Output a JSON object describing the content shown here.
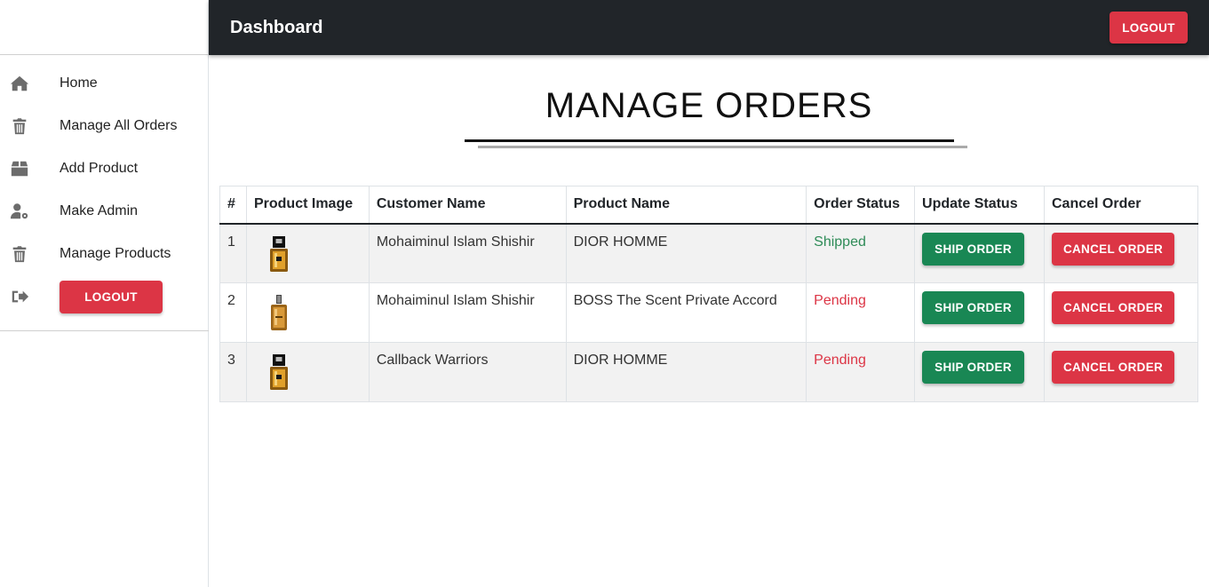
{
  "header": {
    "title": "Dashboard",
    "logout_label": "LOGOUT"
  },
  "sidebar": {
    "items": [
      {
        "label": "Home",
        "icon": "home-icon"
      },
      {
        "label": "Manage All Orders",
        "icon": "trash-icon"
      },
      {
        "label": "Add Product",
        "icon": "box-icon"
      },
      {
        "label": "Make Admin",
        "icon": "user-gear-icon"
      },
      {
        "label": "Manage Products",
        "icon": "trash-icon"
      }
    ],
    "logout": {
      "icon": "sign-out-icon",
      "label": "LOGOUT"
    }
  },
  "main": {
    "title": "MANAGE ORDERS",
    "table": {
      "headers": [
        "#",
        "Product Image",
        "Customer Name",
        "Product Name",
        "Order Status",
        "Update Status",
        "Cancel Order"
      ],
      "rows": [
        {
          "num": "1",
          "customer": "Mohaiminul Islam Shishir",
          "product": "DIOR HOMME",
          "status": "Shipped",
          "ship_label": "SHIP ORDER",
          "cancel_label": "CANCEL ORDER"
        },
        {
          "num": "2",
          "customer": "Mohaiminul Islam Shishir",
          "product": "BOSS The Scent Private Accord",
          "status": "Pending",
          "ship_label": "SHIP ORDER",
          "cancel_label": "CANCEL ORDER"
        },
        {
          "num": "3",
          "customer": "Callback Warriors",
          "product": "DIOR HOMME",
          "status": "Pending",
          "ship_label": "SHIP ORDER",
          "cancel_label": "CANCEL ORDER"
        }
      ]
    }
  },
  "colors": {
    "header_bg": "#212529",
    "danger": "#dc3545",
    "success": "#198754",
    "shipped_text": "#2e8b57"
  }
}
